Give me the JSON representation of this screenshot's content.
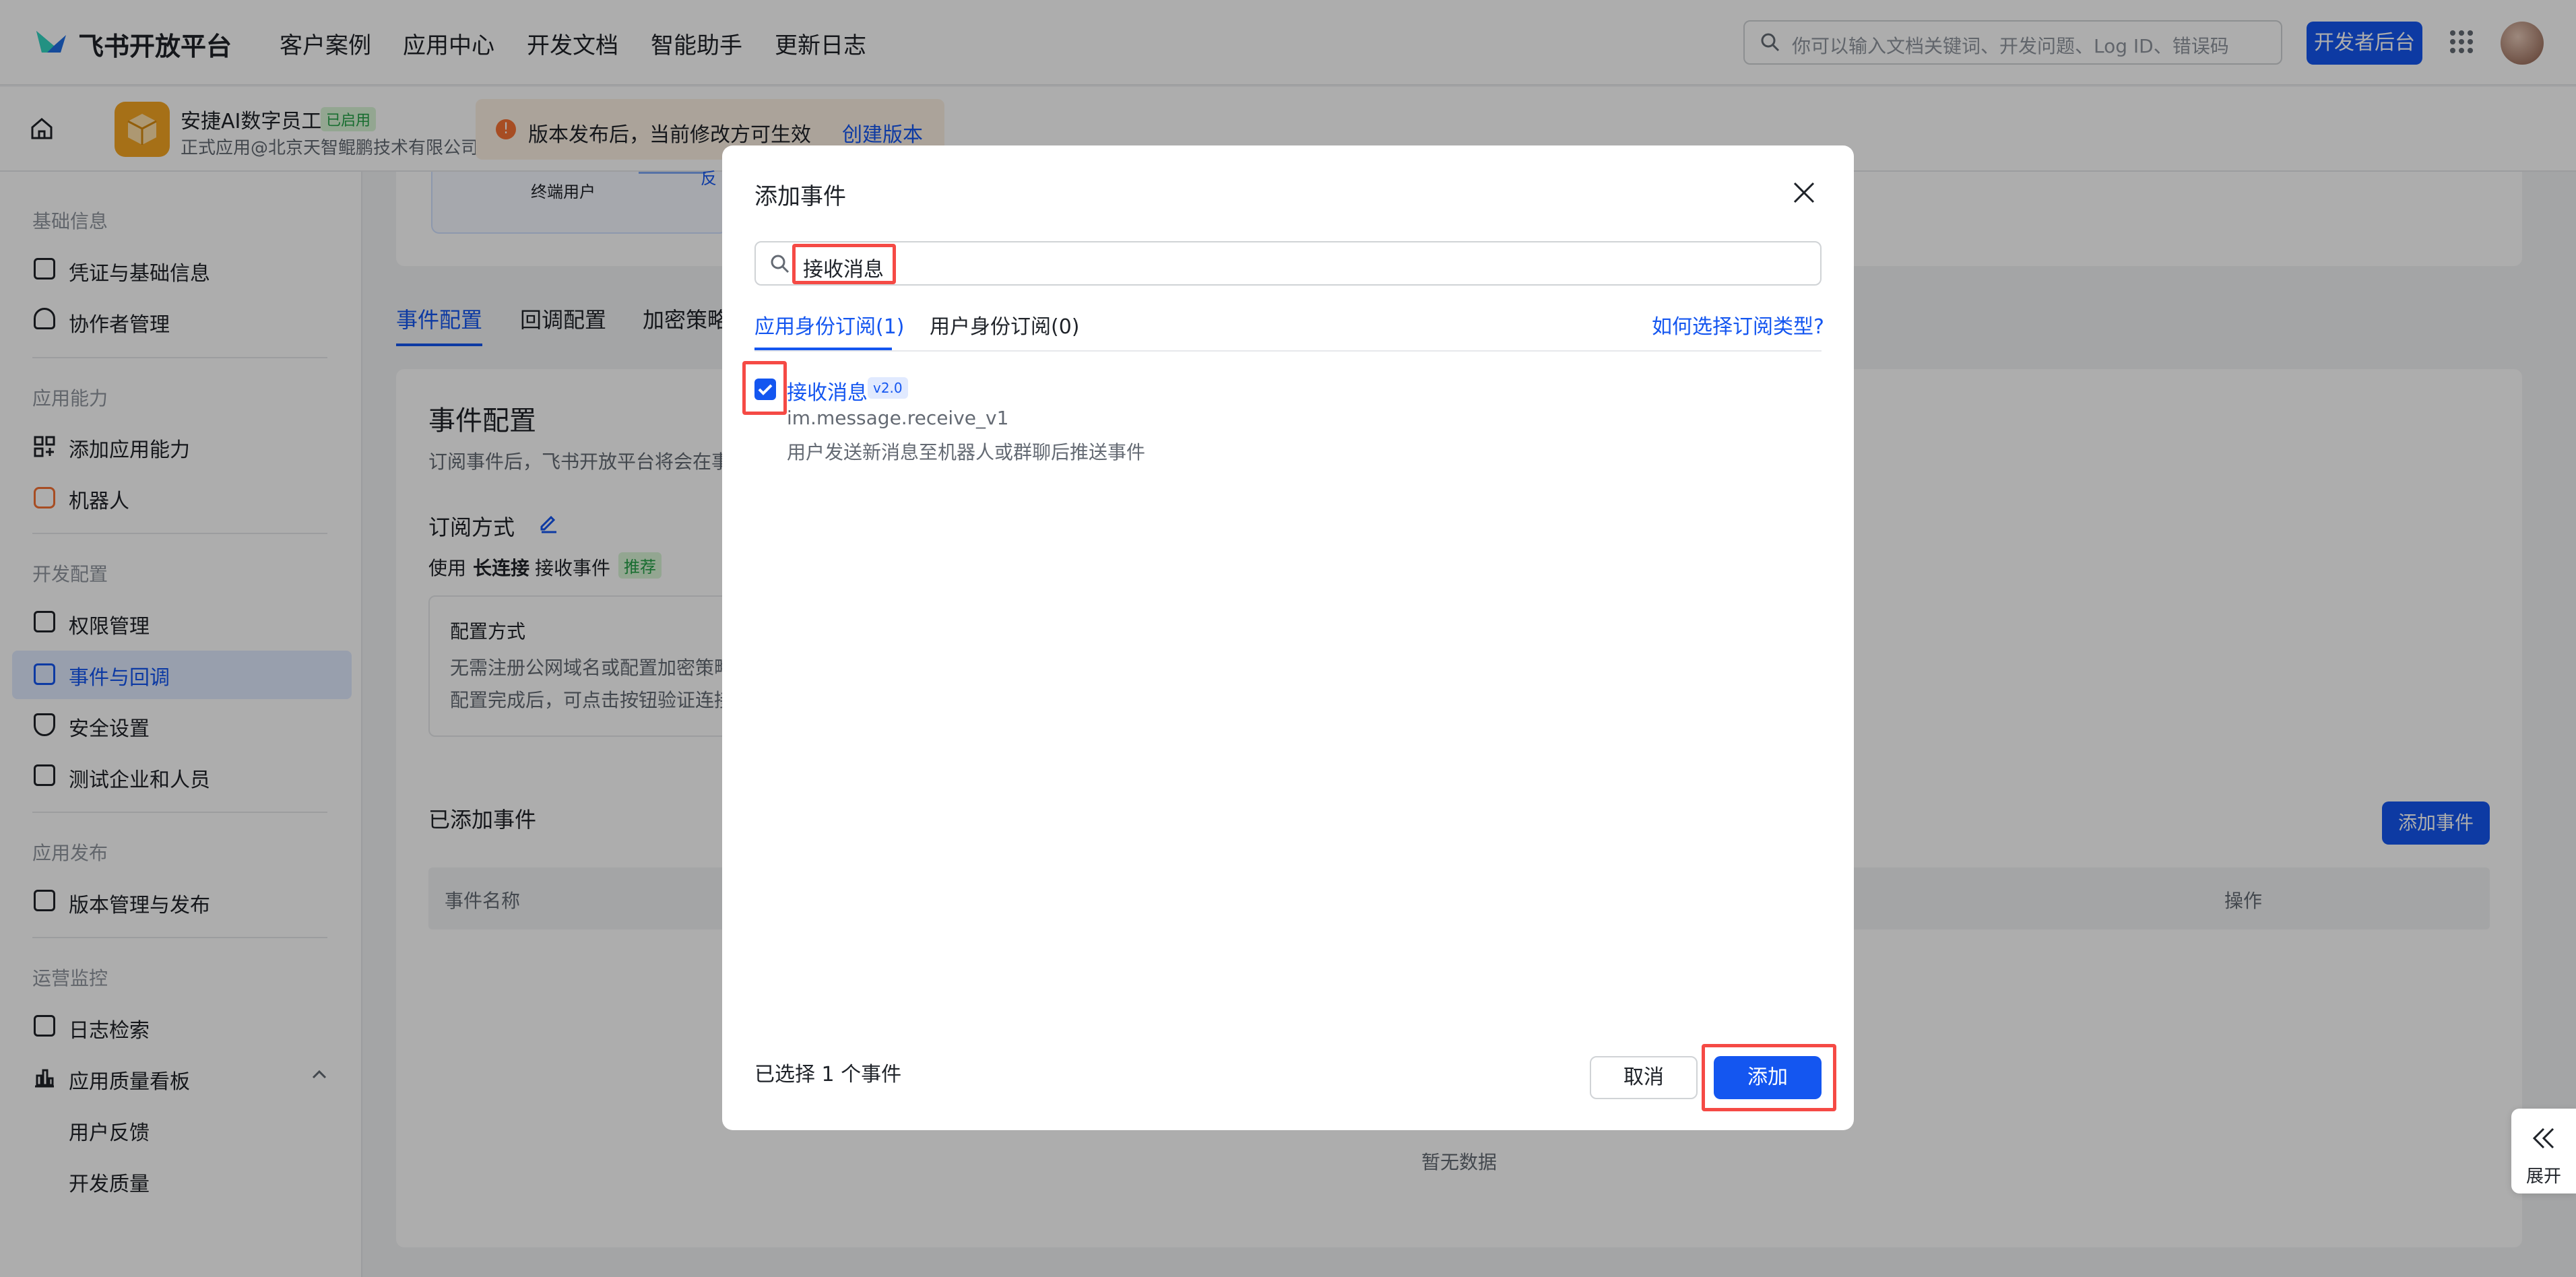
{
  "topnav": {
    "logo_text": "飞书开放平台",
    "items": [
      "客户案例",
      "应用中心",
      "开发文档",
      "智能助手",
      "更新日志"
    ],
    "search_placeholder": "你可以输入文档关键词、开发问题、Log ID、错误码",
    "dev_console_label": "开发者后台"
  },
  "subheader": {
    "app_name": "安捷AI数字员工",
    "app_status": "已启用",
    "app_owner": "正式应用@北京天智鲲鹏技术有限公司",
    "notice_text": "版本发布后，当前修改方可生效",
    "notice_link": "创建版本"
  },
  "sidebar": {
    "groups": [
      {
        "title": "基础信息",
        "items": [
          "凭证与基础信息",
          "协作者管理"
        ]
      },
      {
        "title": "应用能力",
        "items": [
          "添加应用能力",
          "机器人"
        ]
      },
      {
        "title": "开发配置",
        "items": [
          "权限管理",
          "事件与回调",
          "安全设置",
          "测试企业和人员"
        ]
      },
      {
        "title": "应用发布",
        "items": [
          "版本管理与发布"
        ]
      },
      {
        "title": "运营监控",
        "items": [
          "日志检索",
          "应用质量看板"
        ]
      }
    ],
    "sub_items": [
      "用户反馈",
      "开发质量"
    ],
    "active_item": "事件与回调"
  },
  "main": {
    "diagram_label": "终端用户",
    "diagram_label2": "反",
    "tabs": [
      "事件配置",
      "回调配置",
      "加密策略"
    ],
    "section_title": "事件配置",
    "section_desc": "订阅事件后，飞书开放平台将会在事",
    "subscribe_label": "订阅方式",
    "subscribe_prefix": "使用",
    "subscribe_bold": "长连接",
    "subscribe_suffix": "接收事件",
    "recommend_badge": "推荐",
    "config_title": "配置方式",
    "config_line1": "无需注册公网域名或配置加密策略",
    "config_line2": "配置完成后，可点击按钮验证连接",
    "added_title": "已添加事件",
    "add_event_btn": "添加事件",
    "table_col_name": "事件名称",
    "table_col_action": "操作",
    "empty_text": "暂无数据"
  },
  "modal": {
    "title": "添加事件",
    "search_value": "接收消息",
    "tabs": [
      "应用身份订阅(1)",
      "用户身份订阅(0)"
    ],
    "help_link": "如何选择订阅类型?",
    "event": {
      "name": "接收消息",
      "version": "v2.0",
      "key": "im.message.receive_v1",
      "desc": "用户发送新消息至机器人或群聊后推送事件",
      "checked": true
    },
    "selected_text": "已选择 1 个事件",
    "cancel_label": "取消",
    "add_label": "添加"
  },
  "expand": {
    "label": "展开"
  },
  "colors": {
    "primary": "#1456f0",
    "highlight": "#f54a45",
    "sidebar_active": "#e1eaff"
  }
}
